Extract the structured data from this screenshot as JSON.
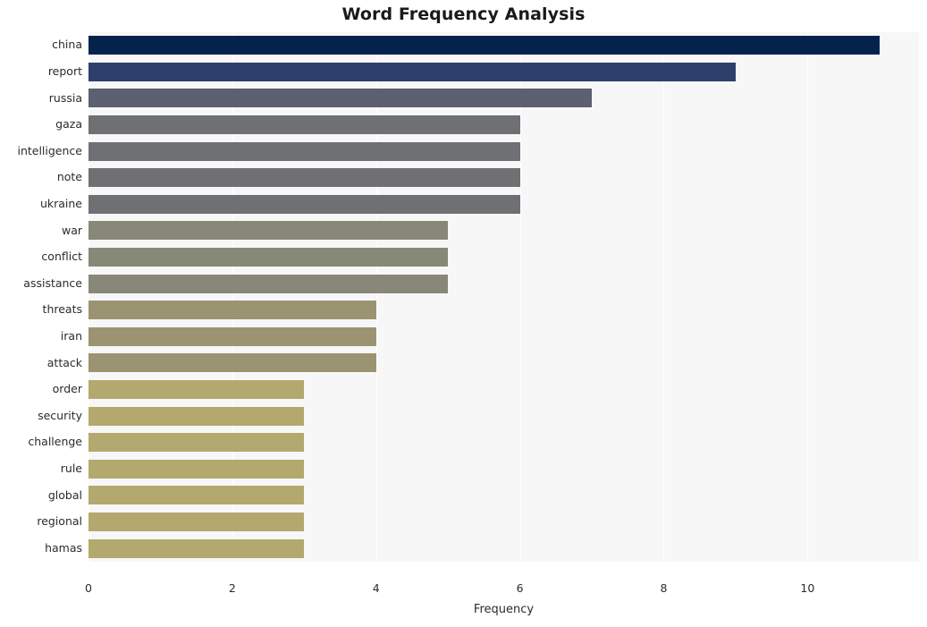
{
  "chart_data": {
    "type": "bar",
    "orientation": "horizontal",
    "title": "Word Frequency Analysis",
    "xlabel": "Frequency",
    "ylabel": "",
    "xlim": [
      0,
      11.55
    ],
    "xticks": [
      0,
      2,
      4,
      6,
      8,
      10
    ],
    "xtick_labels": [
      "0",
      "2",
      "4",
      "6",
      "8",
      "10"
    ],
    "grid": "vertical-white-on-light-panel",
    "legend": "none",
    "plot_background": "#f7f7f8",
    "figure_background": "#ffffff",
    "categories": [
      "china",
      "report",
      "russia",
      "gaza",
      "intelligence",
      "note",
      "ukraine",
      "war",
      "conflict",
      "assistance",
      "threats",
      "iran",
      "attack",
      "order",
      "security",
      "challenge",
      "rule",
      "global",
      "regional",
      "hamas"
    ],
    "values": [
      11,
      9,
      7,
      6,
      6,
      6,
      6,
      5,
      5,
      5,
      4,
      4,
      4,
      3,
      3,
      3,
      3,
      3,
      3,
      3
    ],
    "bar_colors": [
      "#04224c",
      "#2f3f6b",
      "#5d6071",
      "#6e7073",
      "#6e7073",
      "#6e7073",
      "#6e7073",
      "#888878",
      "#888878",
      "#888878",
      "#9b9472",
      "#9b9472",
      "#9b9472",
      "#b3a96e",
      "#b3a96e",
      "#b3a96e",
      "#b3a96e",
      "#b3a96e",
      "#b3a96e",
      "#b3a96e"
    ],
    "bars": [
      {
        "label": "china",
        "value": 11,
        "color": "#04224c"
      },
      {
        "label": "report",
        "value": 9,
        "color": "#2f3f6b"
      },
      {
        "label": "russia",
        "value": 7,
        "color": "#5d6071"
      },
      {
        "label": "gaza",
        "value": 6,
        "color": "#6e7073"
      },
      {
        "label": "intelligence",
        "value": 6,
        "color": "#6e7073"
      },
      {
        "label": "note",
        "value": 6,
        "color": "#6e7073"
      },
      {
        "label": "ukraine",
        "value": 6,
        "color": "#6e7073"
      },
      {
        "label": "war",
        "value": 5,
        "color": "#888878"
      },
      {
        "label": "conflict",
        "value": 5,
        "color": "#888878"
      },
      {
        "label": "assistance",
        "value": 5,
        "color": "#888878"
      },
      {
        "label": "threats",
        "value": 4,
        "color": "#9b9472"
      },
      {
        "label": "iran",
        "value": 4,
        "color": "#9b9472"
      },
      {
        "label": "attack",
        "value": 4,
        "color": "#9b9472"
      },
      {
        "label": "order",
        "value": 3,
        "color": "#b3a96e"
      },
      {
        "label": "security",
        "value": 3,
        "color": "#b3a96e"
      },
      {
        "label": "challenge",
        "value": 3,
        "color": "#b3a96e"
      },
      {
        "label": "rule",
        "value": 3,
        "color": "#b3a96e"
      },
      {
        "label": "global",
        "value": 3,
        "color": "#b3a96e"
      },
      {
        "label": "regional",
        "value": 3,
        "color": "#b3a96e"
      },
      {
        "label": "hamas",
        "value": 3,
        "color": "#b3a96e"
      }
    ]
  }
}
